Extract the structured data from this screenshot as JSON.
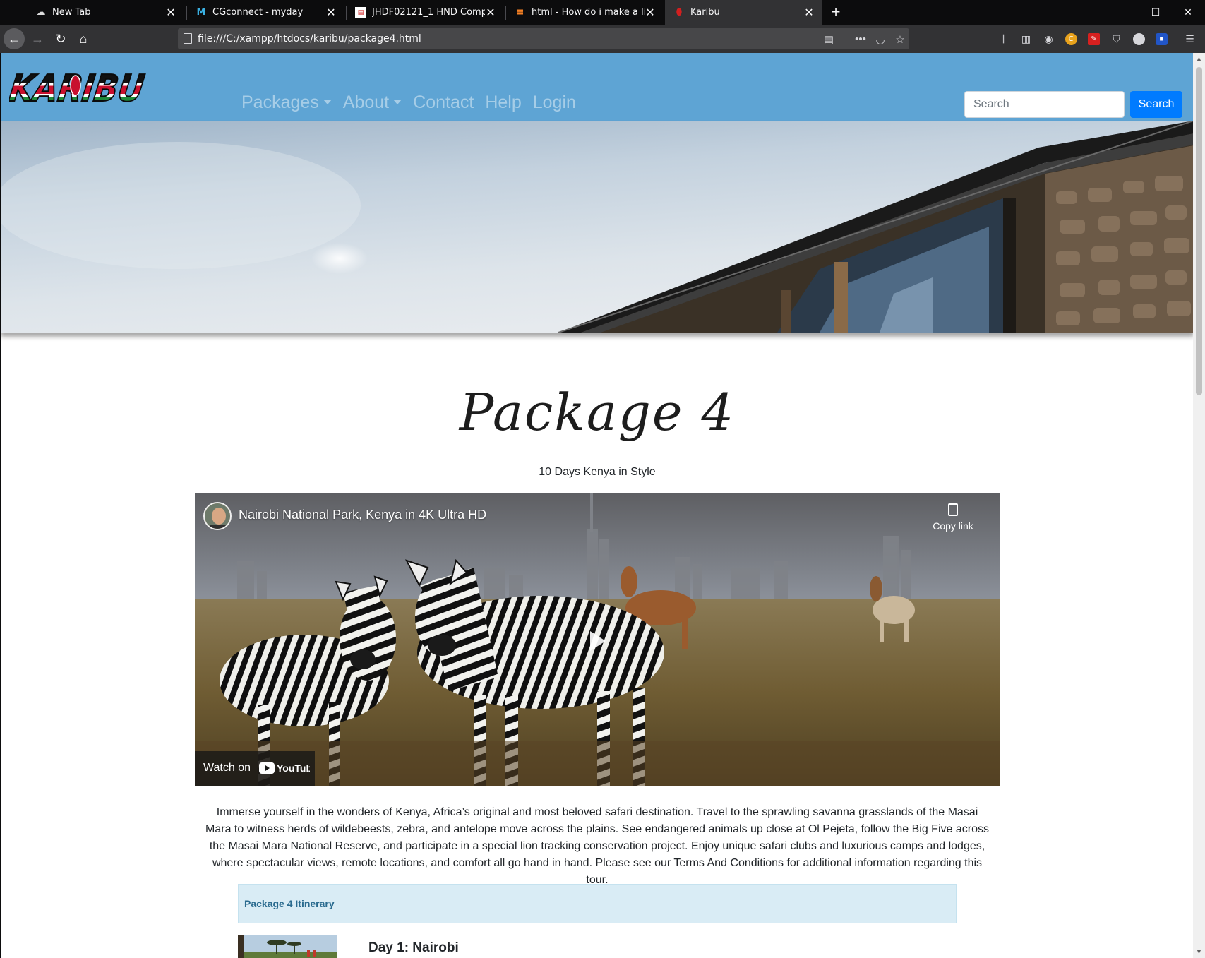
{
  "browser": {
    "tabs": [
      {
        "title": "New Tab",
        "icon": "cloud-icon"
      },
      {
        "title": "CGconnect - myday",
        "icon": "m-logo-icon"
      },
      {
        "title": "JHDF02121_1 HND Computing",
        "icon": "pdf-icon"
      },
      {
        "title": "html - How do i make a link wh",
        "icon": "stackoverflow-icon"
      },
      {
        "title": "Karibu",
        "icon": "kenya-shield-icon"
      }
    ],
    "url": "file:///C:/xampp/htdocs/karibu/package4.html"
  },
  "site": {
    "logo_text": "KARIBU",
    "nav": {
      "packages": "Packages",
      "about": "About",
      "contact": "Contact",
      "help": "Help",
      "login": "Login"
    },
    "search": {
      "placeholder": "Search",
      "button": "Search"
    }
  },
  "content": {
    "title": "Package 4",
    "subtitle": "10 Days Kenya in Style",
    "video": {
      "title": "Nairobi National Park, Kenya in 4K Ultra HD",
      "copy_link": "Copy link",
      "watch_on": "Watch on",
      "platform": "YouTube"
    },
    "description": "Immerse yourself in the wonders of Kenya, Africa’s original and most beloved safari destination. Travel to the sprawling savanna grasslands of the Masai Mara to witness herds of wildebeests, zebra, and antelope move across the plains. See endangered animals up close at Ol Pejeta, follow the Big Five across the Masai Mara National Reserve, and participate in a special lion tracking conservation project. Enjoy unique safari clubs and luxurious camps and lodges, where spectacular views, remote locations, and comfort all go hand in hand. Please see our Terms And Conditions for additional information regarding this tour.",
    "itinerary_title": "Package 4 Itinerary",
    "day1": "Day 1: Nairobi"
  }
}
